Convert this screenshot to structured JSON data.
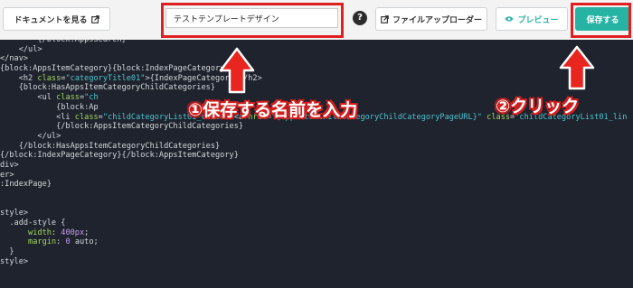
{
  "toolbar": {
    "docs_label": "ドキュメントを見る",
    "template_name": "テストテンプレートデザイン",
    "help_label": "?",
    "upload_label": "ファイルアップローダー",
    "preview_label": "プレビュー",
    "save_label": "保存する",
    "icons": {
      "docs": "external-link-icon",
      "upload": "external-link-icon",
      "preview": "eye-icon",
      "help": "question-icon"
    }
  },
  "annotations": {
    "step1": "①保存する名前を入力",
    "step2": "②クリック",
    "highlight_color": "#e02020"
  },
  "code_lines": [
    [
      {
        "t": "        {/block:AppsSearch}",
        "c": "tag"
      }
    ],
    [
      {
        "t": "    </ul>",
        "c": "tag"
      }
    ],
    [
      {
        "t": "</nav>",
        "c": "tag"
      }
    ],
    [
      {
        "t": "{block:AppsItemCategory}{block:IndexPageCategory}",
        "c": "tag"
      }
    ],
    [
      {
        "t": "    <h2 ",
        "c": "tag"
      },
      {
        "t": "class",
        "c": "attr"
      },
      {
        "t": "=",
        "c": "tag"
      },
      {
        "t": "\"categoryTitle01\"",
        "c": "str"
      },
      {
        "t": ">{IndexPageCategory}</h2>",
        "c": "tag"
      }
    ],
    [
      {
        "t": "    {block:HasAppsItemCategoryChildCategories}",
        "c": "tag"
      }
    ],
    [
      {
        "t": "        <ul ",
        "c": "tag"
      },
      {
        "t": "class",
        "c": "attr"
      },
      {
        "t": "=",
        "c": "tag"
      },
      {
        "t": "\"ch",
        "c": "str"
      }
    ],
    [
      {
        "t": "            {block:Ap",
        "c": "tag"
      }
    ],
    [
      {
        "t": "            <li ",
        "c": "tag"
      },
      {
        "t": "class",
        "c": "attr"
      },
      {
        "t": "=",
        "c": "tag"
      },
      {
        "t": "\"childCategoryList01_child\"",
        "c": "str"
      },
      {
        "t": "><a ",
        "c": "tag"
      },
      {
        "t": "href",
        "c": "attr"
      },
      {
        "t": "=",
        "c": "tag"
      },
      {
        "t": "\"{AppsItemChildCategoryChildCategoryPageURL}\"",
        "c": "str"
      },
      {
        "t": " ",
        "c": "tag"
      },
      {
        "t": "class",
        "c": "attr"
      },
      {
        "t": "=",
        "c": "tag"
      },
      {
        "t": "\"childCategoryList01_lin",
        "c": "str"
      }
    ],
    [
      {
        "t": "            {/block:AppsItemCategoryChildCategories}",
        "c": "tag"
      }
    ],
    [
      {
        "t": "        </ul>",
        "c": "tag"
      }
    ],
    [
      {
        "t": "    {/block:HasAppsItemCategoryChildCategories}",
        "c": "tag"
      }
    ],
    [
      {
        "t": "{/block:IndexPageCategory}{/block:AppsItemCategory}",
        "c": "tag"
      }
    ],
    [
      {
        "t": "div>",
        "c": "tag"
      }
    ],
    [
      {
        "t": "er>",
        "c": "tag"
      }
    ],
    [
      {
        "t": ":IndexPage}",
        "c": "tag"
      }
    ],
    [
      {
        "t": "",
        "c": "tag"
      }
    ],
    [
      {
        "t": "",
        "c": "tag"
      }
    ],
    [
      {
        "t": "style>",
        "c": "tag"
      }
    ],
    [
      {
        "t": "  .add-style {",
        "c": "tag"
      }
    ],
    [
      {
        "t": "      ",
        "c": "tag"
      },
      {
        "t": "width",
        "c": "attr"
      },
      {
        "t": ": ",
        "c": "tag"
      },
      {
        "t": "400px",
        "c": "num"
      },
      {
        "t": ";",
        "c": "tag"
      }
    ],
    [
      {
        "t": "      ",
        "c": "tag"
      },
      {
        "t": "margin",
        "c": "attr"
      },
      {
        "t": ": ",
        "c": "tag"
      },
      {
        "t": "0",
        "c": "num"
      },
      {
        "t": " auto;",
        "c": "tag"
      }
    ],
    [
      {
        "t": "  }",
        "c": "tag"
      }
    ],
    [
      {
        "t": "style>",
        "c": "tag"
      }
    ]
  ]
}
